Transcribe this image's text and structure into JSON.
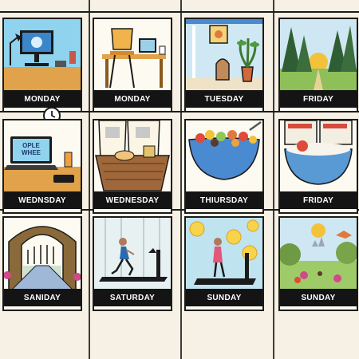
{
  "cards": [
    {
      "label": "MONDAY"
    },
    {
      "label": "MONDAY"
    },
    {
      "label": "TUESDAY"
    },
    {
      "label": "FRIDAY"
    },
    {
      "label": "WEDNSDAY",
      "screen_text": "OPLE WHEE"
    },
    {
      "label": "WEDNESDAY"
    },
    {
      "label": "THIURSDAY"
    },
    {
      "label": "FRIDAY"
    },
    {
      "label": "SANIDAY"
    },
    {
      "label": "SATURDAY"
    },
    {
      "label": "SUNDAY"
    },
    {
      "label": "SUNDAY"
    }
  ],
  "colors": {
    "page_bg": "#f6f1e4",
    "label_bg": "#141414",
    "label_text": "#ffffff",
    "sky_blue": "#8fd3ee",
    "wood": "#e0a24a"
  }
}
